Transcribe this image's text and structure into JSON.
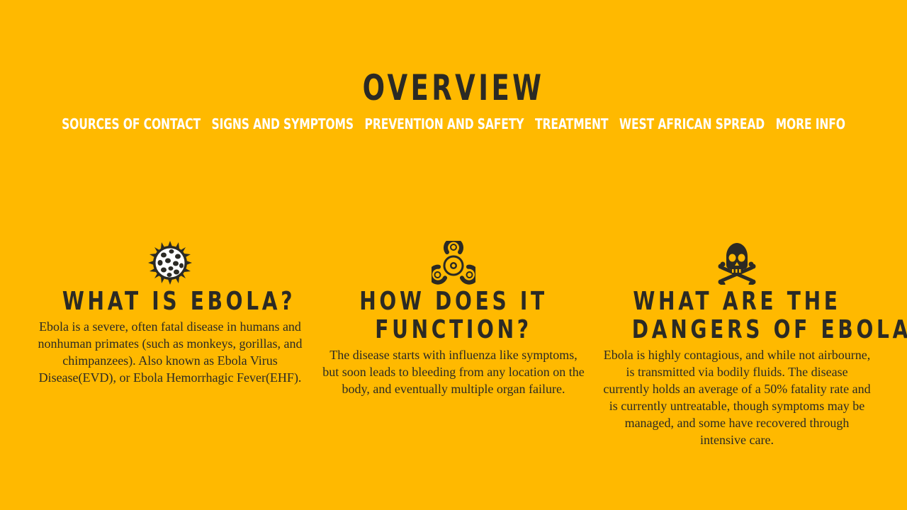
{
  "page": {
    "title": "OVERVIEW",
    "background_color": "#ffb900",
    "text_color": "#2b2a24",
    "nav_color": "#ffffff"
  },
  "nav": {
    "items": [
      {
        "label": "SOURCES OF CONTACT"
      },
      {
        "label": "SIGNS AND SYMPTOMS"
      },
      {
        "label": "PREVENTION AND SAFETY"
      },
      {
        "label": "TREATMENT"
      },
      {
        "label": "WEST AFRICAN SPREAD"
      },
      {
        "label": "MORE INFO"
      }
    ]
  },
  "sections": [
    {
      "icon": "virus-icon",
      "heading_lines": [
        "WHAT IS EBOLA?"
      ],
      "text": "Ebola is a severe, often fatal disease in humans and nonhuman primates (such as monkeys, gorillas, and chimpanzees). Also known as Ebola Virus Disease(EVD), or Ebola Hemorrhagic Fever(EHF)."
    },
    {
      "icon": "biohazard-icon",
      "heading_lines": [
        "HOW DOES IT",
        "FUNCTION?"
      ],
      "text": "The disease starts with influenza like symptoms, but soon leads to bleeding from any location on the body, and eventually multiple organ failure."
    },
    {
      "icon": "skull-crossbones-icon",
      "heading_lines": [
        "WHAT ARE THE",
        "DANGERS OF EBOLA?"
      ],
      "text": "Ebola is highly contagious, and while not airbourne, is transmitted via bodily fluids. The disease currently holds an average of a 50% fatality rate and is currently untreatable, though symptoms may be managed, and some have recovered through intensive care."
    }
  ]
}
